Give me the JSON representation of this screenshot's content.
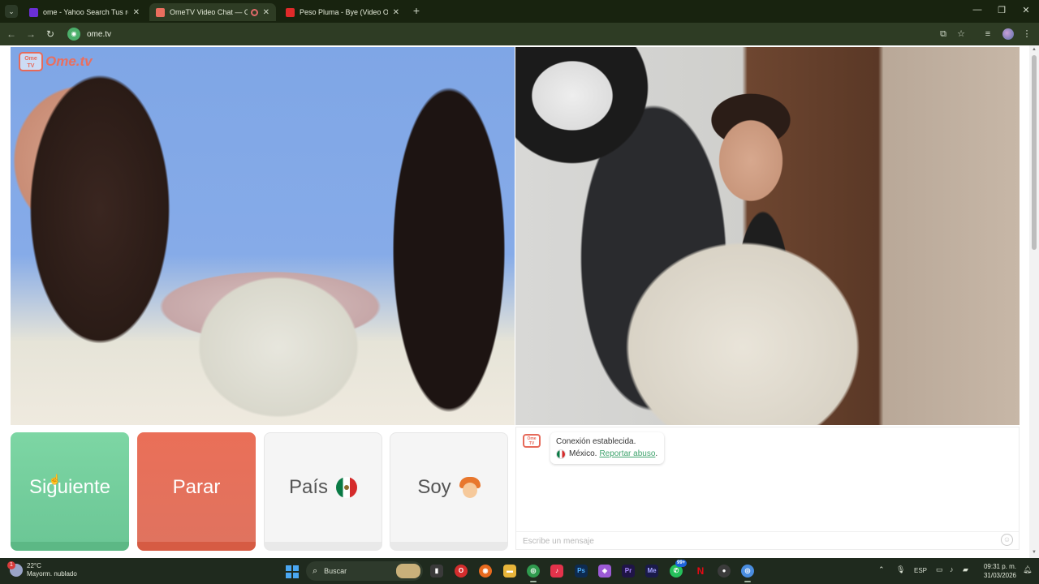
{
  "browser": {
    "tabs": [
      {
        "title": "ome - Yahoo Search Tus resulta",
        "favicon_color": "#6b2fd6"
      },
      {
        "title": "OmeTV Video Chat — Ome",
        "favicon_color": "#ea6e5e",
        "recording": true
      },
      {
        "title": "Peso Pluma - Bye (Video Oficial",
        "favicon_color": "#e02a2a"
      }
    ],
    "url": "ome.tv"
  },
  "site": {
    "logo_badge": "Ome\nTV",
    "logo_text": "Ome.tv"
  },
  "controls": {
    "next_label": "Siguiente",
    "stop_label": "Parar",
    "country_label": "País",
    "gender_label": "Soy"
  },
  "chat": {
    "avatar_label": "Ome\nTV",
    "status_line": "Conexión establecida.",
    "country": "México.",
    "report_link": "Reportar abuso",
    "report_suffix": ".",
    "input_placeholder": "Escribe un mensaje"
  },
  "taskbar": {
    "weather_temp": "22°C",
    "weather_desc": "Mayorm. nublado",
    "weather_badge": "1",
    "search_placeholder": "Buscar",
    "whatsapp_badge": "99+",
    "language": "ESP",
    "time": "09:31 p. m.",
    "date": "31/03/2026"
  },
  "colors": {
    "next": "#7dd6a4",
    "stop": "#ea6f58",
    "brand": "#ea6e5e",
    "link": "#3fa36d"
  }
}
